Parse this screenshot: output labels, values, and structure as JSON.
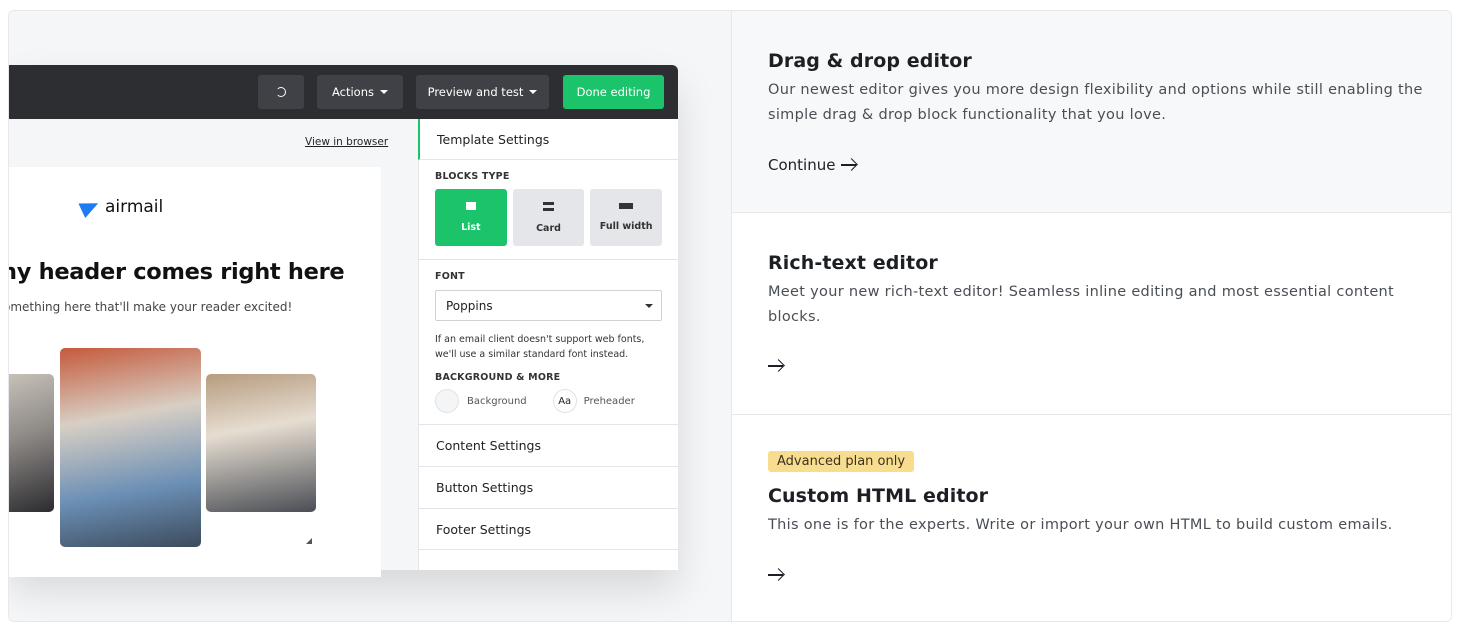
{
  "preview": {
    "topbar": {
      "actions_label": "Actions",
      "preview_label": "Preview and test",
      "done_label": "Done editing"
    },
    "email": {
      "view_in_browser": "View in browser",
      "logo_text": "airmail",
      "header": "ny header comes right here",
      "subtext": "omething here that'll make your reader excited!"
    },
    "panel": {
      "template_settings": "Template Settings",
      "blocks_type_label": "BLOCKS TYPE",
      "blocks": [
        {
          "label": "List",
          "active": true
        },
        {
          "label": "Card",
          "active": false
        },
        {
          "label": "Full width",
          "active": false
        }
      ],
      "font_label": "FONT",
      "font_value": "Poppins",
      "font_hint": "If an email client doesn't support web fonts, we'll use a similar standard font instead.",
      "bg_label": "BACKGROUND & MORE",
      "background_label": "Background",
      "preheader_icon": "Aa",
      "preheader_label": "Preheader",
      "content_settings": "Content Settings",
      "button_settings": "Button Settings",
      "footer_settings": "Footer Settings"
    },
    "colors": {
      "accent_green": "#1bc46b",
      "topbar": "#2c2e32"
    }
  },
  "options": [
    {
      "title": "Drag & drop editor",
      "description": "Our newest editor gives you more design flexibility and options while still enabling the simple drag & drop block functionality that you love.",
      "cta": "Continue"
    },
    {
      "title": "Rich-text editor",
      "description": "Meet your new rich-text editor! Seamless inline editing and most essential content blocks.",
      "cta": ""
    },
    {
      "badge": "Advanced plan only",
      "title": "Custom HTML editor",
      "description": "This one is for the experts. Write or import your own HTML to build custom emails.",
      "cta": ""
    }
  ]
}
